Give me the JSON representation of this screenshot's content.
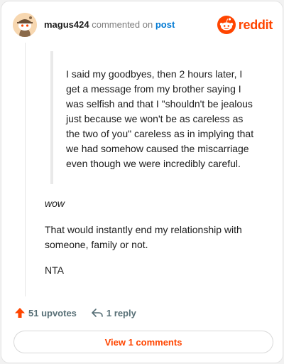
{
  "comment": {
    "username": "magus424",
    "action_text": "commented on",
    "post_link": "post",
    "avatar_icon": "snoo-avatar-icon",
    "quote": "I said my goodbyes, then 2 hours later, I get a message from my brother saying I was selfish and that I \"shouldn't be jealous just because we won't be as careless as the two of you\" careless as in implying that we had somehow caused the miscarriage even though we were incredibly careful.",
    "paragraphs": [
      "wow",
      "That would instantly end my relationship with someone, family or not.",
      "NTA"
    ]
  },
  "brand": {
    "wordmark": "reddit",
    "logo_icon": "reddit-logo-icon",
    "accent_color": "#ff4500"
  },
  "actions": {
    "upvotes": "51 upvotes",
    "upvote_icon": "upvote-arrow-icon",
    "replies": "1 reply",
    "reply_icon": "reply-arrow-icon"
  },
  "footer": {
    "view_comments": "View 1 comments"
  }
}
